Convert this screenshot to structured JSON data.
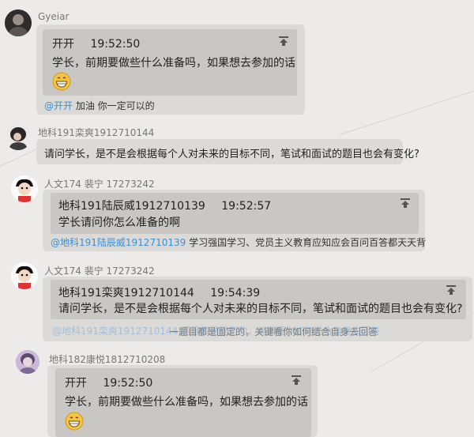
{
  "messages": [
    {
      "sender": "Gyeiar",
      "quote_author": "开开",
      "quote_time": "19:52:50",
      "quote_text": "学长，前期要做些什么准备吗，如果想去参加的话",
      "reply_mention": "@开开",
      "reply_text": " 加油 你一定可以的"
    },
    {
      "sender": "地科191栾爽1912710144",
      "text": "请问学长，是不是会根据每个人对未来的目标不同，笔试和面试的题目也会有变化?"
    },
    {
      "sender": "人文174 裴宁 17273242",
      "quote_author": "地科191陆辰威1912710139",
      "quote_time": "19:52:57",
      "quote_text": "学长请问你怎么准备的啊",
      "reply_mention": "@地科191陆辰威1912710139",
      "reply_text": " 学习强国学习、党员主义教育应知应会百问百答都天天背"
    },
    {
      "sender": "人文174 裴宁 17273242",
      "quote_author": "地科191栾爽1912710144",
      "quote_time": "19:54:39",
      "quote_text": "请问学长，是不是会根据每个人对未来的目标不同，笔试和面试的题目也会有变化?",
      "reply_overlap_a": "@地科191栾爽1912710144 题目都是固定的，关键看你如何结合自身去回答",
      "reply_overlap_b": "一题目都是固定的，关键看你如何结合自身去回答"
    },
    {
      "sender": "地科182康悦1812710208",
      "quote_author": "开开",
      "quote_time": "19:52:50",
      "quote_text": "学长，前期要做些什么准备吗，如果想去参加的话"
    }
  ],
  "colors": {
    "background": "#ecebe9",
    "bubble": "#dcdad7",
    "quote": "#c9c7c4",
    "mention": "#3b8fd6",
    "name": "#777777"
  },
  "icons": [
    "pin-icon",
    "grin-emoji-icon",
    "avatar-icon"
  ]
}
